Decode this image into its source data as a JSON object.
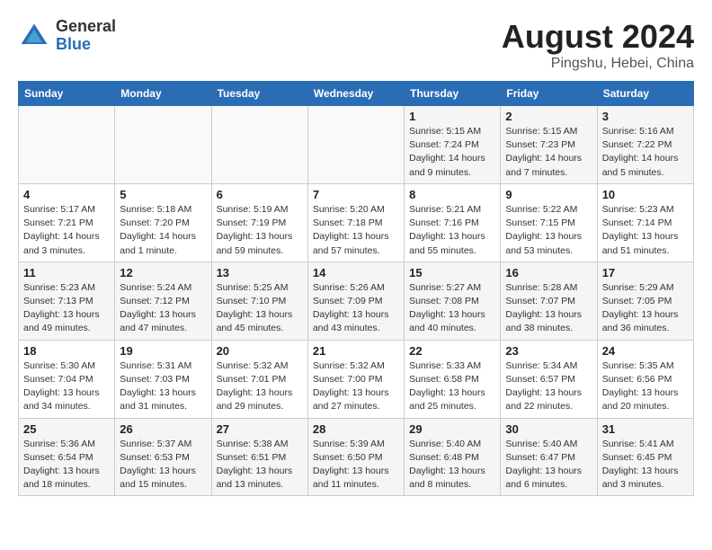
{
  "logo": {
    "line1": "General",
    "line2": "Blue"
  },
  "title": "August 2024",
  "subtitle": "Pingshu, Hebei, China",
  "days_of_week": [
    "Sunday",
    "Monday",
    "Tuesday",
    "Wednesday",
    "Thursday",
    "Friday",
    "Saturday"
  ],
  "weeks": [
    [
      {
        "day": "",
        "info": ""
      },
      {
        "day": "",
        "info": ""
      },
      {
        "day": "",
        "info": ""
      },
      {
        "day": "",
        "info": ""
      },
      {
        "day": "1",
        "info": "Sunrise: 5:15 AM\nSunset: 7:24 PM\nDaylight: 14 hours\nand 9 minutes."
      },
      {
        "day": "2",
        "info": "Sunrise: 5:15 AM\nSunset: 7:23 PM\nDaylight: 14 hours\nand 7 minutes."
      },
      {
        "day": "3",
        "info": "Sunrise: 5:16 AM\nSunset: 7:22 PM\nDaylight: 14 hours\nand 5 minutes."
      }
    ],
    [
      {
        "day": "4",
        "info": "Sunrise: 5:17 AM\nSunset: 7:21 PM\nDaylight: 14 hours\nand 3 minutes."
      },
      {
        "day": "5",
        "info": "Sunrise: 5:18 AM\nSunset: 7:20 PM\nDaylight: 14 hours\nand 1 minute."
      },
      {
        "day": "6",
        "info": "Sunrise: 5:19 AM\nSunset: 7:19 PM\nDaylight: 13 hours\nand 59 minutes."
      },
      {
        "day": "7",
        "info": "Sunrise: 5:20 AM\nSunset: 7:18 PM\nDaylight: 13 hours\nand 57 minutes."
      },
      {
        "day": "8",
        "info": "Sunrise: 5:21 AM\nSunset: 7:16 PM\nDaylight: 13 hours\nand 55 minutes."
      },
      {
        "day": "9",
        "info": "Sunrise: 5:22 AM\nSunset: 7:15 PM\nDaylight: 13 hours\nand 53 minutes."
      },
      {
        "day": "10",
        "info": "Sunrise: 5:23 AM\nSunset: 7:14 PM\nDaylight: 13 hours\nand 51 minutes."
      }
    ],
    [
      {
        "day": "11",
        "info": "Sunrise: 5:23 AM\nSunset: 7:13 PM\nDaylight: 13 hours\nand 49 minutes."
      },
      {
        "day": "12",
        "info": "Sunrise: 5:24 AM\nSunset: 7:12 PM\nDaylight: 13 hours\nand 47 minutes."
      },
      {
        "day": "13",
        "info": "Sunrise: 5:25 AM\nSunset: 7:10 PM\nDaylight: 13 hours\nand 45 minutes."
      },
      {
        "day": "14",
        "info": "Sunrise: 5:26 AM\nSunset: 7:09 PM\nDaylight: 13 hours\nand 43 minutes."
      },
      {
        "day": "15",
        "info": "Sunrise: 5:27 AM\nSunset: 7:08 PM\nDaylight: 13 hours\nand 40 minutes."
      },
      {
        "day": "16",
        "info": "Sunrise: 5:28 AM\nSunset: 7:07 PM\nDaylight: 13 hours\nand 38 minutes."
      },
      {
        "day": "17",
        "info": "Sunrise: 5:29 AM\nSunset: 7:05 PM\nDaylight: 13 hours\nand 36 minutes."
      }
    ],
    [
      {
        "day": "18",
        "info": "Sunrise: 5:30 AM\nSunset: 7:04 PM\nDaylight: 13 hours\nand 34 minutes."
      },
      {
        "day": "19",
        "info": "Sunrise: 5:31 AM\nSunset: 7:03 PM\nDaylight: 13 hours\nand 31 minutes."
      },
      {
        "day": "20",
        "info": "Sunrise: 5:32 AM\nSunset: 7:01 PM\nDaylight: 13 hours\nand 29 minutes."
      },
      {
        "day": "21",
        "info": "Sunrise: 5:32 AM\nSunset: 7:00 PM\nDaylight: 13 hours\nand 27 minutes."
      },
      {
        "day": "22",
        "info": "Sunrise: 5:33 AM\nSunset: 6:58 PM\nDaylight: 13 hours\nand 25 minutes."
      },
      {
        "day": "23",
        "info": "Sunrise: 5:34 AM\nSunset: 6:57 PM\nDaylight: 13 hours\nand 22 minutes."
      },
      {
        "day": "24",
        "info": "Sunrise: 5:35 AM\nSunset: 6:56 PM\nDaylight: 13 hours\nand 20 minutes."
      }
    ],
    [
      {
        "day": "25",
        "info": "Sunrise: 5:36 AM\nSunset: 6:54 PM\nDaylight: 13 hours\nand 18 minutes."
      },
      {
        "day": "26",
        "info": "Sunrise: 5:37 AM\nSunset: 6:53 PM\nDaylight: 13 hours\nand 15 minutes."
      },
      {
        "day": "27",
        "info": "Sunrise: 5:38 AM\nSunset: 6:51 PM\nDaylight: 13 hours\nand 13 minutes."
      },
      {
        "day": "28",
        "info": "Sunrise: 5:39 AM\nSunset: 6:50 PM\nDaylight: 13 hours\nand 11 minutes."
      },
      {
        "day": "29",
        "info": "Sunrise: 5:40 AM\nSunset: 6:48 PM\nDaylight: 13 hours\nand 8 minutes."
      },
      {
        "day": "30",
        "info": "Sunrise: 5:40 AM\nSunset: 6:47 PM\nDaylight: 13 hours\nand 6 minutes."
      },
      {
        "day": "31",
        "info": "Sunrise: 5:41 AM\nSunset: 6:45 PM\nDaylight: 13 hours\nand 3 minutes."
      }
    ]
  ]
}
